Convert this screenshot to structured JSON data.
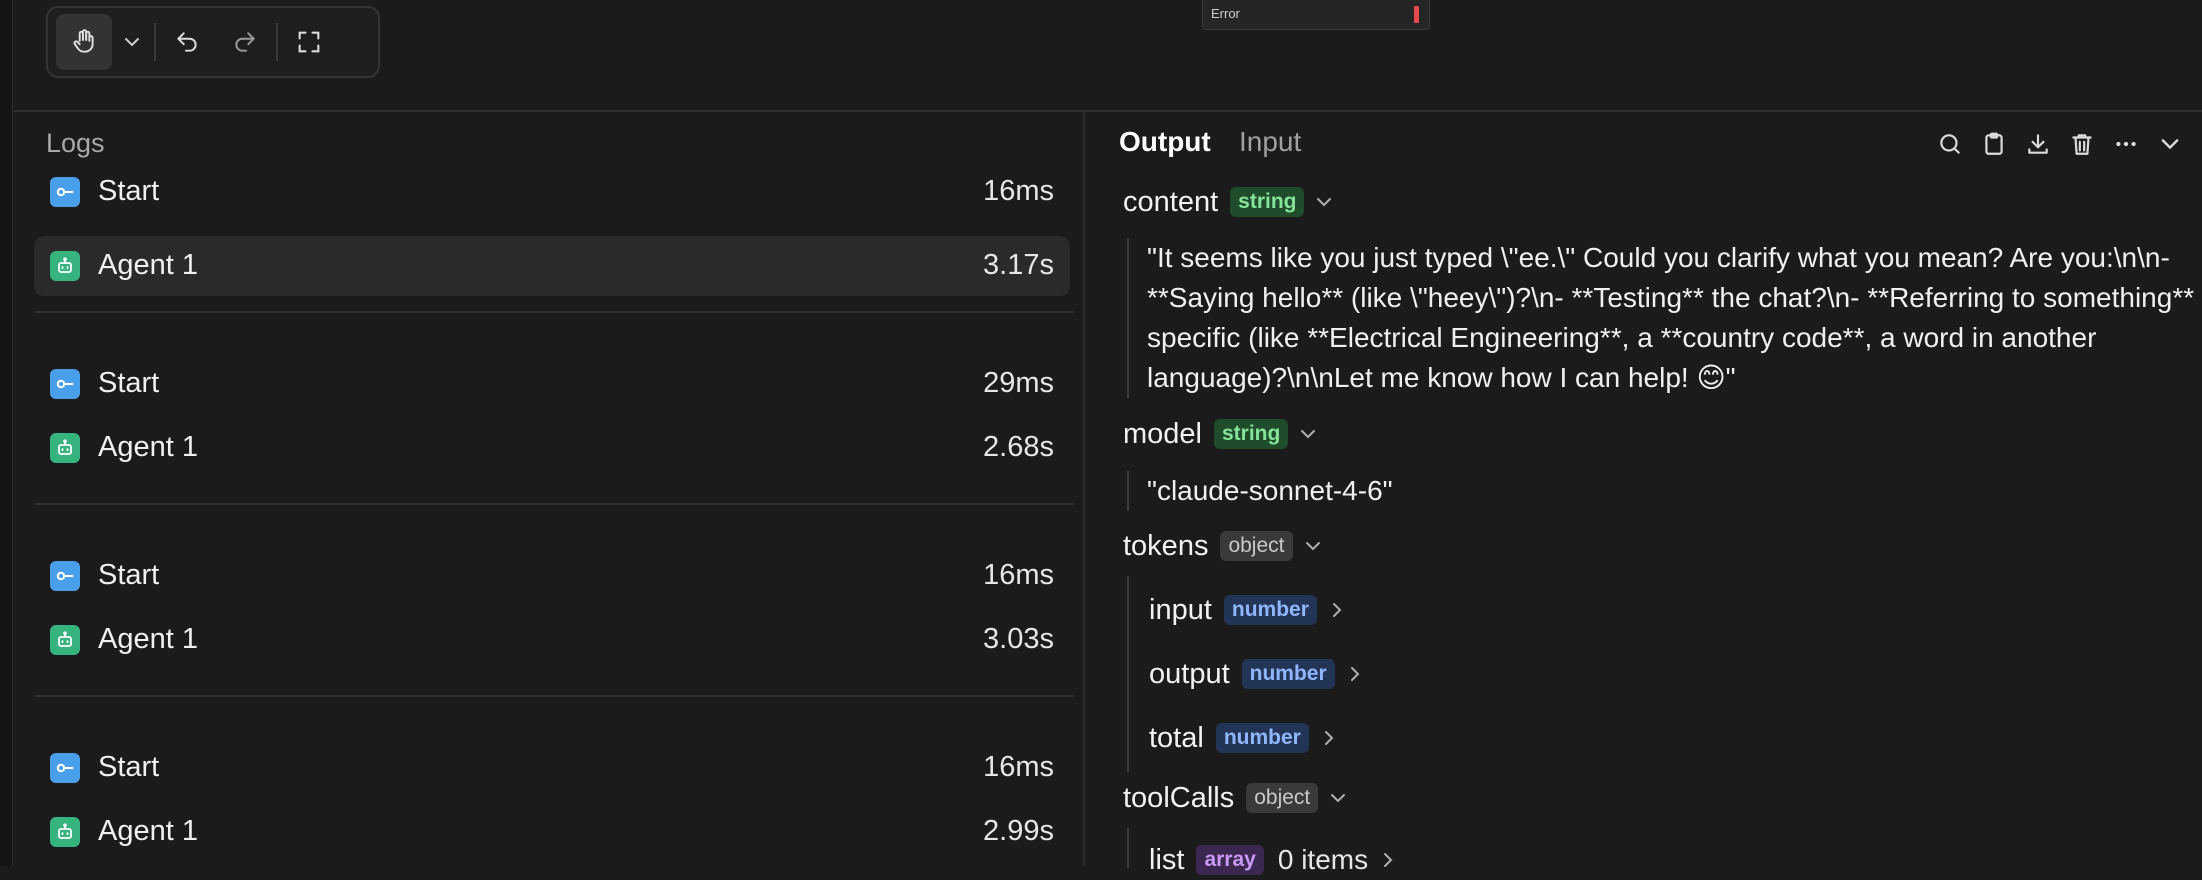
{
  "toolbar": {
    "hand_icon": "hand-icon",
    "chevron_icon": "chevron-down-icon",
    "undo_icon": "undo-icon",
    "redo_icon": "redo-icon",
    "fullscreen_icon": "fullscreen-icon"
  },
  "canvas_node": {
    "label": "Error",
    "status_color": "#e5484d"
  },
  "logs": {
    "title": "Logs",
    "rows": [
      {
        "label": "Start",
        "duration": "16ms",
        "kind": "start",
        "selected": false
      },
      {
        "label": "Agent 1",
        "duration": "3.17s",
        "kind": "agent",
        "selected": true
      },
      {
        "label": "Start",
        "duration": "29ms",
        "kind": "start",
        "selected": false
      },
      {
        "label": "Agent 1",
        "duration": "2.68s",
        "kind": "agent",
        "selected": false
      },
      {
        "label": "Start",
        "duration": "16ms",
        "kind": "start",
        "selected": false
      },
      {
        "label": "Agent 1",
        "duration": "3.03s",
        "kind": "agent",
        "selected": false
      },
      {
        "label": "Start",
        "duration": "16ms",
        "kind": "start",
        "selected": false
      },
      {
        "label": "Agent 1",
        "duration": "2.99s",
        "kind": "agent",
        "selected": false
      }
    ]
  },
  "output": {
    "tabs": {
      "output": "Output",
      "input": "Input"
    },
    "actions": [
      "search-icon",
      "clipboard-icon",
      "download-icon",
      "trash-icon",
      "more-icon",
      "chevron-down-icon"
    ],
    "fields": {
      "content": {
        "name": "content",
        "type": "string",
        "value": "\"It seems like you just typed \\\"ee.\\\" Could you clarify what you mean? Are you:\\n\\n- **Saying hello** (like \\\"heey\\\")?\\n- **Testing** the chat?\\n- **Referring to something** specific (like **Electrical Engineering**, a **country code**, a word in another language)?\\n\\nLet me know how I can help! 😊\""
      },
      "model": {
        "name": "model",
        "type": "string",
        "value": "\"claude-sonnet-4-6\""
      },
      "tokens": {
        "name": "tokens",
        "type": "object",
        "children": [
          {
            "name": "input",
            "type": "number"
          },
          {
            "name": "output",
            "type": "number"
          },
          {
            "name": "total",
            "type": "number"
          }
        ]
      },
      "toolCalls": {
        "name": "toolCalls",
        "type": "object",
        "children": [
          {
            "name": "list",
            "type": "array",
            "extra": "0 items"
          }
        ]
      }
    }
  },
  "colors": {
    "start_icon": "#4a9fea",
    "agent_icon": "#36b37e",
    "string_badge": "#1f4d2b",
    "number_badge": "#233556",
    "array_badge": "#3c2750"
  }
}
